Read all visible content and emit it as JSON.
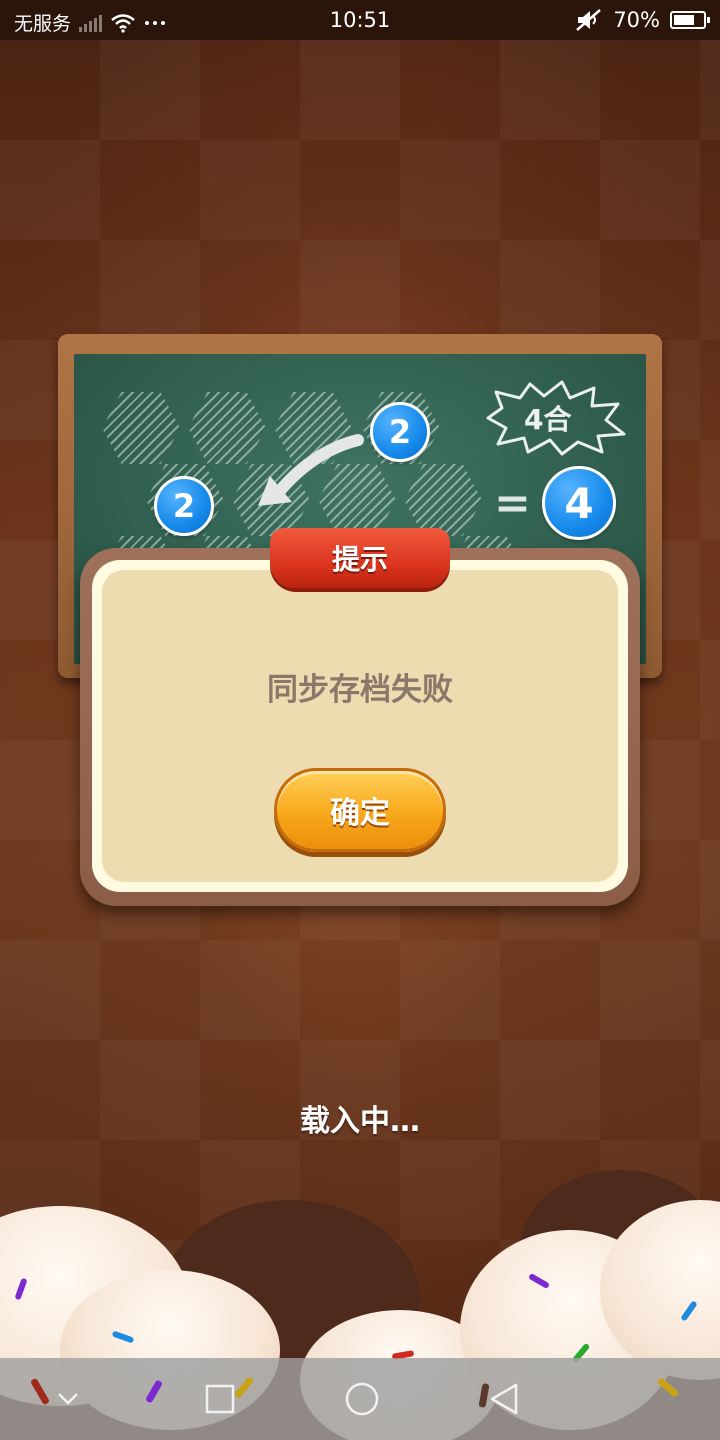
{
  "status_bar": {
    "carrier": "无服务",
    "time": "10:51",
    "battery": "70%",
    "battery_level": 0.7,
    "icons": [
      "signal-icon",
      "wifi-icon",
      "more-icon",
      "mute-icon",
      "battery-icon"
    ]
  },
  "tutorial_board": {
    "bubble_top": "2",
    "bubble_left": "2",
    "burst_label": "4合",
    "equals_sign": "=",
    "result_bubble": "4"
  },
  "dialog": {
    "title": "提示",
    "message": "同步存档失败",
    "confirm_label": "确定"
  },
  "loading": {
    "text": "载入中…"
  },
  "nav_bar": {
    "icons": [
      "chevron-down-icon",
      "square-icon",
      "circle-icon",
      "back-triangle-icon"
    ]
  },
  "colors": {
    "background": "#6b341b",
    "board": "#2e5b4c",
    "bubble": "#1589ea",
    "ribbon": "#d9331d",
    "button": "#f7a81b",
    "dialog_panel": "#ecdcb0"
  }
}
